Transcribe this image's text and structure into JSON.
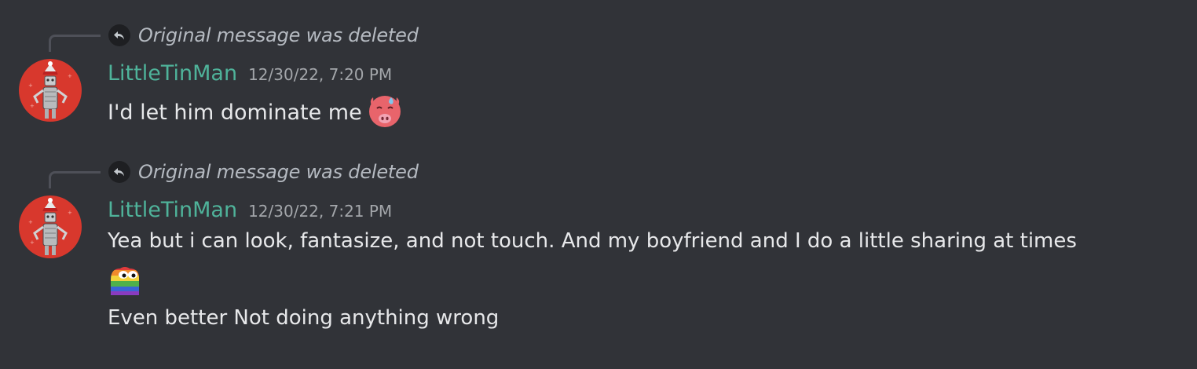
{
  "messages": [
    {
      "reply": {
        "text": "Original message was deleted",
        "icon": "reply-arrow-icon"
      },
      "author": "LittleTinMan",
      "timestamp": "12/30/22, 7:20 PM",
      "lines": [
        {
          "text": "I'd let him dominate me",
          "emoji": "hot-face-emoji"
        }
      ]
    },
    {
      "reply": {
        "text": "Original message was deleted",
        "icon": "reply-arrow-icon"
      },
      "author": "LittleTinMan",
      "timestamp": "12/30/22, 7:21 PM",
      "lines": [
        {
          "text": "Yea but i can look, fantasize, and not touch. And my boyfriend and I do a little sharing at times"
        },
        {
          "text": "",
          "emoji": "rainbow-pepe-emoji"
        },
        {
          "text": "Even better Not doing anything wrong"
        }
      ]
    }
  ],
  "colors": {
    "background": "#313338",
    "username": "#4fb39a",
    "text": "#e7e8ea",
    "muted": "#b5bac1",
    "avatar_bg": "#d8382d"
  }
}
